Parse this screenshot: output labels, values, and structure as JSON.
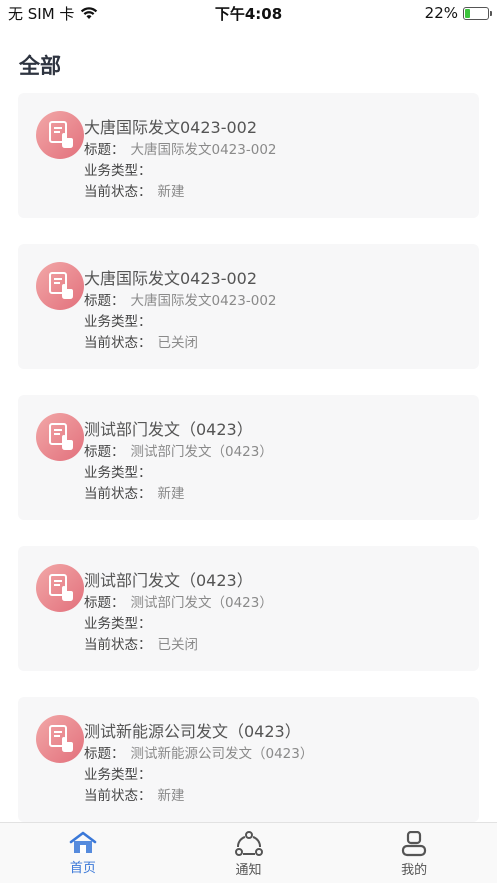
{
  "status_bar": {
    "carrier": "无 SIM 卡",
    "time": "下午4:08",
    "battery": "22%",
    "battery_level": 0.22
  },
  "page": {
    "title": "全部"
  },
  "labels": {
    "subject": "标题：",
    "business_type": "业务类型：",
    "state": "当前状态："
  },
  "cards": [
    {
      "title": "大唐国际发文0423-002",
      "subject": "大唐国际发文0423-002",
      "business_type": "",
      "state": "新建"
    },
    {
      "title": "大唐国际发文0423-002",
      "subject": "大唐国际发文0423-002",
      "business_type": "",
      "state": "已关闭"
    },
    {
      "title": "测试部门发文（0423）",
      "subject": "测试部门发文（0423）",
      "business_type": "",
      "state": "新建"
    },
    {
      "title": "测试部门发文（0423）",
      "subject": "测试部门发文（0423）",
      "business_type": "",
      "state": "已关闭"
    },
    {
      "title": "测试新能源公司发文（0423）",
      "subject": "测试新能源公司发文（0423）",
      "business_type": "",
      "state": "新建"
    }
  ],
  "tabbar": [
    {
      "label": "首页",
      "icon": "home-icon",
      "active": true
    },
    {
      "label": "通知",
      "icon": "share-icon",
      "active": false
    },
    {
      "label": "我的",
      "icon": "user-icon",
      "active": false
    }
  ],
  "colors": {
    "accent": "#3a78d8",
    "icon_gradient_start": "#f2a8a8",
    "icon_gradient_end": "#e2707c",
    "card_bg": "#f7f7f8"
  }
}
